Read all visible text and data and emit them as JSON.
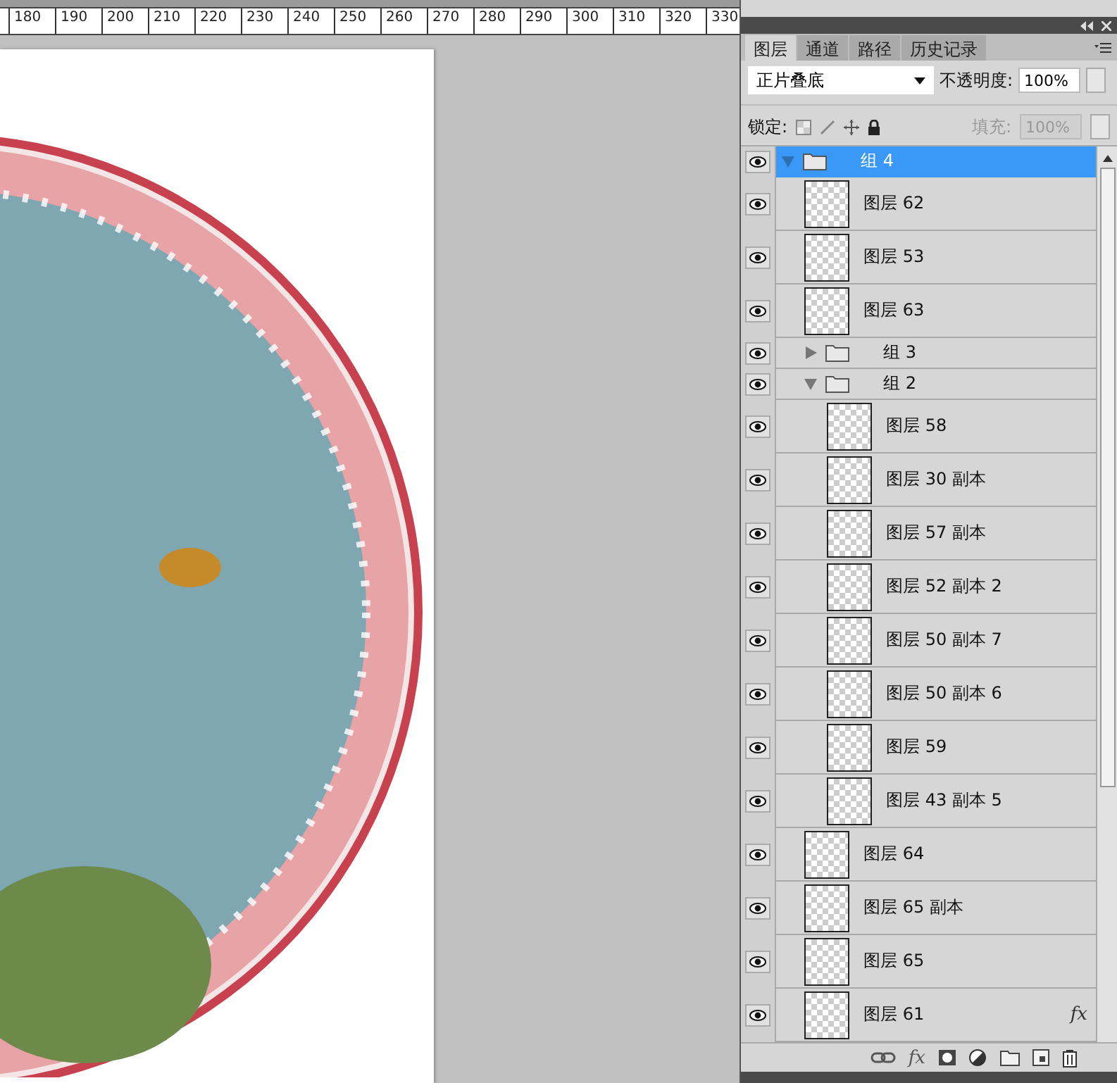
{
  "ruler": {
    "labels": [
      "180",
      "190",
      "200",
      "210",
      "220",
      "230",
      "240",
      "250",
      "260",
      "270",
      "280",
      "290",
      "300",
      "310",
      "320",
      "330"
    ]
  },
  "layers_panel": {
    "tabs": [
      {
        "label": "图层",
        "selected": true
      },
      {
        "label": "通道",
        "selected": false
      },
      {
        "label": "路径",
        "selected": false
      },
      {
        "label": "历史记录",
        "selected": false
      }
    ],
    "blend_mode": "正片叠底",
    "opacity_label": "不透明度:",
    "opacity": "100%",
    "lock_label": "锁定:",
    "fill_label": "填充:",
    "fill": "100%",
    "fill_disabled": true,
    "layers": [
      {
        "kind": "group",
        "name": "组 4",
        "expanded": true,
        "selected": true,
        "visible": true,
        "children": [
          {
            "kind": "layer",
            "name": "图层 62",
            "selected": false,
            "visible": true
          },
          {
            "kind": "layer",
            "name": "图层 53",
            "selected": false,
            "visible": true
          },
          {
            "kind": "layer",
            "name": "图层 63",
            "selected": false,
            "visible": true
          },
          {
            "kind": "group",
            "name": "组 3",
            "expanded": false,
            "selected": false,
            "visible": true
          },
          {
            "kind": "group",
            "name": "组 2",
            "expanded": true,
            "selected": false,
            "visible": true,
            "children": [
              {
                "kind": "layer",
                "name": "图层 58",
                "selected": false,
                "visible": true
              },
              {
                "kind": "layer",
                "name": "图层 30 副本",
                "selected": false,
                "visible": true
              },
              {
                "kind": "layer",
                "name": "图层 57 副本",
                "selected": false,
                "visible": true
              },
              {
                "kind": "layer",
                "name": "图层 52 副本 2",
                "selected": false,
                "visible": true
              },
              {
                "kind": "layer",
                "name": "图层 50 副本 7",
                "selected": false,
                "visible": true
              },
              {
                "kind": "layer",
                "name": "图层 50 副本 6",
                "selected": false,
                "visible": true
              },
              {
                "kind": "layer",
                "name": "图层 59",
                "selected": false,
                "visible": true
              },
              {
                "kind": "layer",
                "name": "图层 43 副本 5",
                "selected": false,
                "visible": true
              }
            ]
          },
          {
            "kind": "layer",
            "name": "图层 64",
            "selected": false,
            "visible": true
          },
          {
            "kind": "layer",
            "name": "图层 65 副本",
            "selected": false,
            "visible": true
          },
          {
            "kind": "layer",
            "name": "图层 65",
            "selected": false,
            "visible": true
          },
          {
            "kind": "layer",
            "name": "图层 61",
            "selected": false,
            "visible": true,
            "fx": "fx"
          }
        ]
      }
    ],
    "footer_buttons": [
      {
        "kind": "link"
      },
      {
        "kind": "fx",
        "label": "fx"
      },
      {
        "kind": "mask"
      },
      {
        "kind": "adjustment"
      },
      {
        "kind": "folder"
      },
      {
        "kind": "new"
      },
      {
        "kind": "trash"
      }
    ]
  }
}
